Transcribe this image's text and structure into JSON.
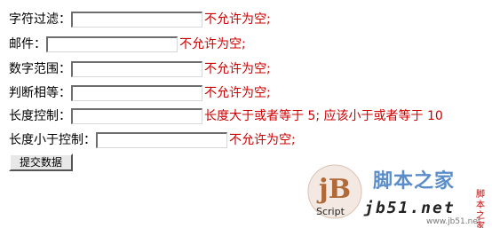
{
  "form": {
    "rows": [
      {
        "label": "字符过滤：",
        "value": "",
        "error": "不允许为空;"
      },
      {
        "label": "邮件：",
        "value": "",
        "error": "不允许为空;"
      },
      {
        "label": "数字范围：",
        "value": "",
        "error": "不允许为空;"
      },
      {
        "label": "判断相等：",
        "value": "",
        "error": "不允许为空;"
      },
      {
        "label": "长度控制：",
        "value": "",
        "error": "长度大于或者等于 5; 应该小于或者等于 10"
      },
      {
        "label": "长度小于控制：",
        "value": "",
        "error": "不允许为空;"
      }
    ],
    "submit_label": "提交数据"
  },
  "watermark": {
    "logo_letters": "jB",
    "logo_caption": "Script",
    "site_name": "脚本之家",
    "domain_text": "jb51.net",
    "side_text": "脚本之家",
    "url": "www.jb51.net",
    "colors": {
      "logo": "#b06a3a",
      "site": "#5b8ec9",
      "error": "#cc0000"
    }
  }
}
